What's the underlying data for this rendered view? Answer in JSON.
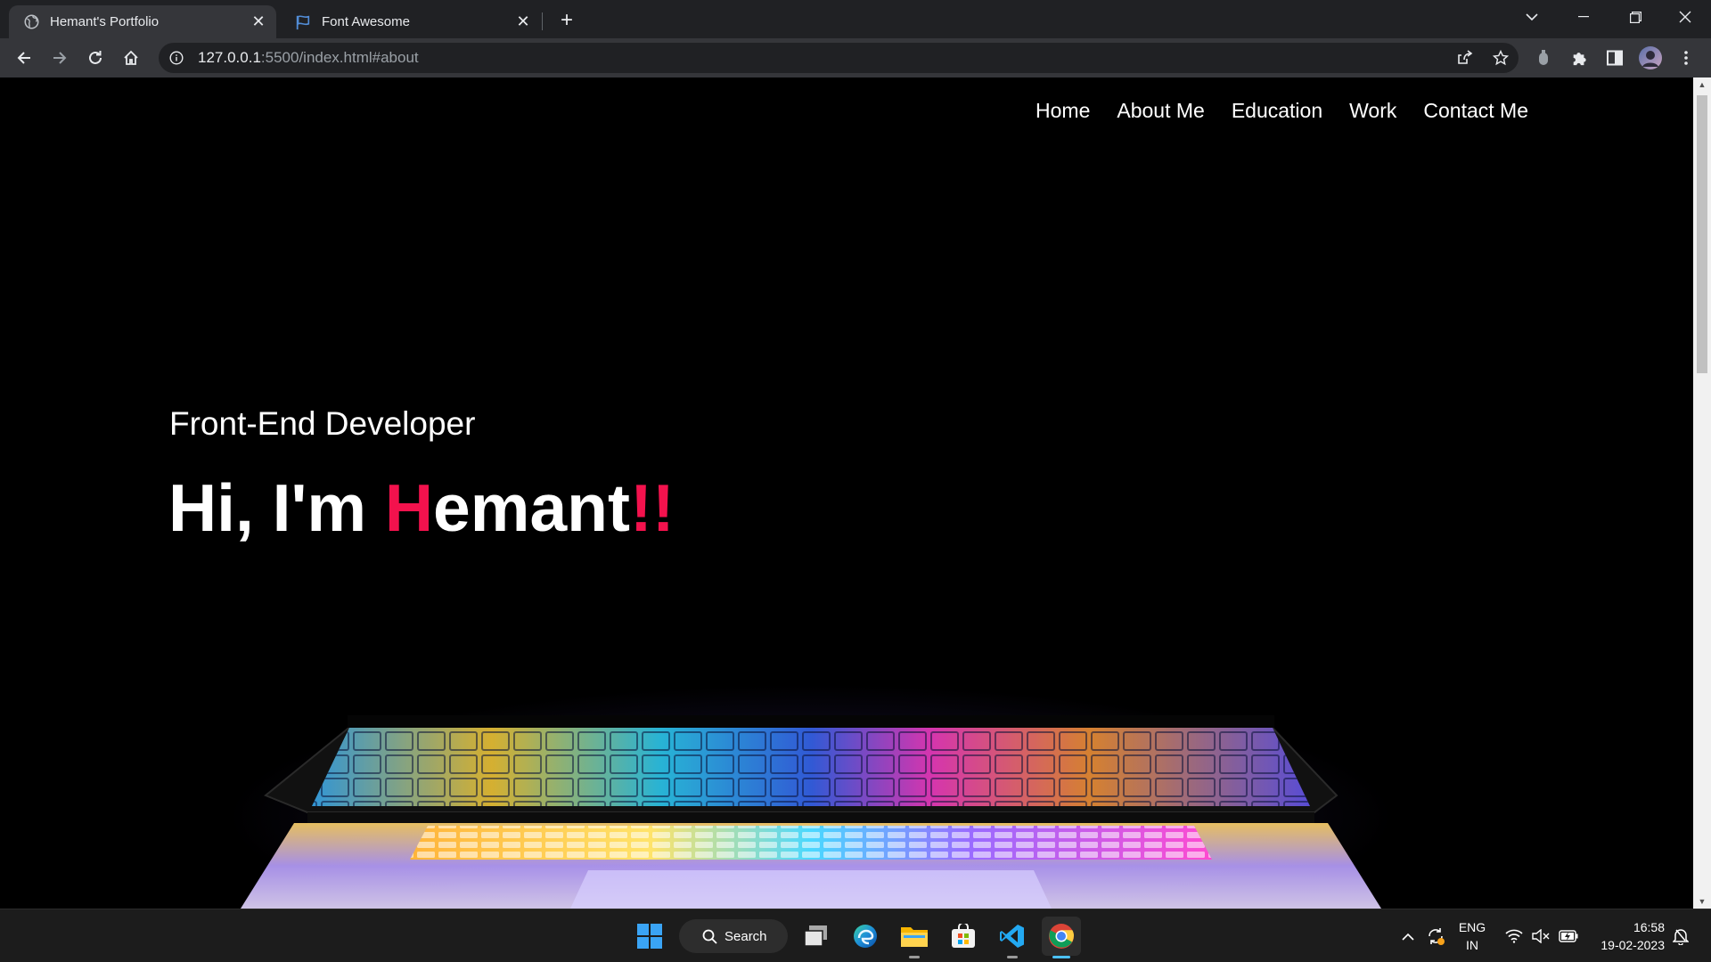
{
  "browser": {
    "tabs": [
      {
        "title": "Hemant's Portfolio",
        "icon": "globe-icon",
        "active": true
      },
      {
        "title": "Font Awesome",
        "icon": "flag-icon",
        "active": false
      }
    ],
    "address": {
      "host": "127.0.0.1",
      "rest": ":5500/index.html#about"
    }
  },
  "page": {
    "nav": [
      "Home",
      "About Me",
      "Education",
      "Work",
      "Contact Me"
    ],
    "subtitle": "Front-End Developer",
    "headline": {
      "before": "Hi, I'm ",
      "accent_letter": "H",
      "name_rest": "emant",
      "accent_bang": "!!"
    },
    "accent_color": "#f3124d"
  },
  "taskbar": {
    "search_label": "Search",
    "apps": [
      "windows-start-icon",
      "task-view-icon",
      "edge-icon",
      "file-explorer-icon",
      "microsoft-store-icon",
      "vscode-icon",
      "chrome-icon"
    ],
    "language": {
      "line1": "ENG",
      "line2": "IN"
    },
    "clock": {
      "time": "16:58",
      "date": "19-02-2023"
    }
  }
}
